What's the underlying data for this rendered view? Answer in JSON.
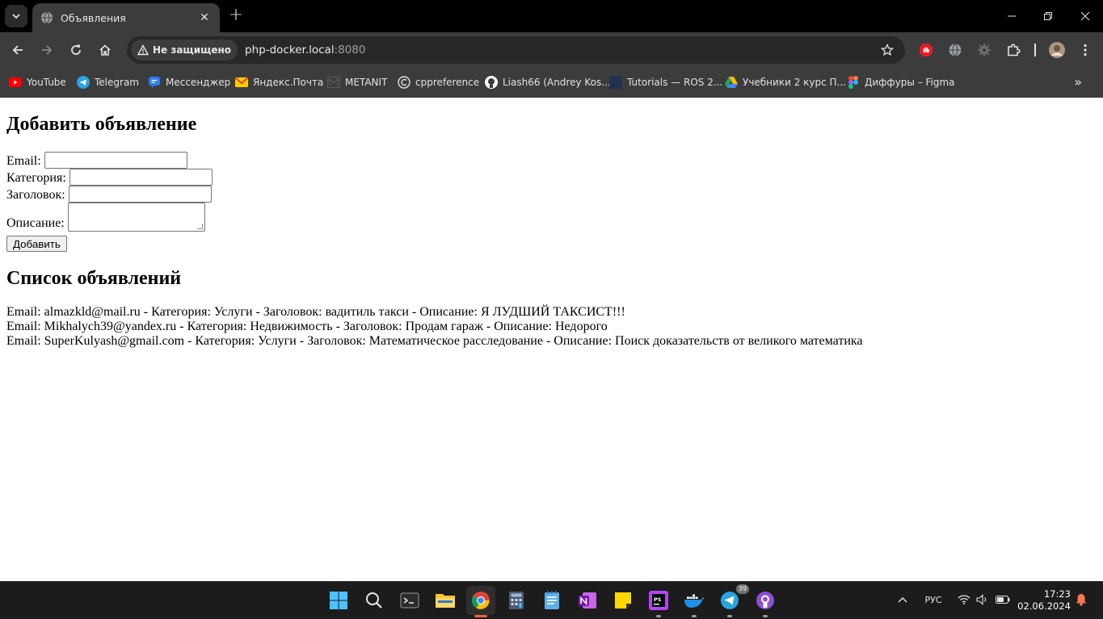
{
  "browser": {
    "tab": {
      "title": "Объявления",
      "favicon": "globe-icon"
    },
    "address": {
      "security_label": "Не защищено",
      "host": "php-docker.local",
      "port": ":8080"
    },
    "bookmarks": [
      {
        "label": "YouTube",
        "icon": "youtube-icon",
        "color": "#ff0000"
      },
      {
        "label": "Telegram",
        "icon": "telegram-icon",
        "color": "#2aa3df"
      },
      {
        "label": "Мессенджер",
        "icon": "messenger-icon",
        "color": "#2f7cf6"
      },
      {
        "label": "Яндекс.Почта",
        "icon": "mail-icon",
        "color": "#ffcc00"
      },
      {
        "label": "METANIT",
        "icon": "metanit-icon",
        "color": "#5a5a5a"
      },
      {
        "label": "cppreference",
        "icon": "cppreference-icon",
        "color": "#e3e3e3"
      },
      {
        "label": "Liash66 (Andrey Kos...",
        "icon": "github-icon",
        "color": "#ffffff"
      },
      {
        "label": "Tutorials — ROS 2...",
        "icon": "ros-icon",
        "color": "#22314e"
      },
      {
        "label": "Учебники 2 курс П...",
        "icon": "google-drive-icon",
        "color": "#1fa463"
      },
      {
        "label": "Диффуры – Figma",
        "icon": "figma-icon",
        "color": "#f24e1e"
      }
    ]
  },
  "page": {
    "form_heading": "Добавить объявление",
    "fields": {
      "email_label": "Email:",
      "category_label": "Категория:",
      "title_label": "Заголовок:",
      "description_label": "Описание:"
    },
    "submit_label": "Добавить",
    "list_heading": "Список объявлений",
    "ads": [
      "Email: almazkld@mail.ru - Категория: Услуги - Заголовок: вадитиль такси - Описание: Я ЛУДШИЙ ТАКСИСТ!!!",
      "Email: Mikhalych39@yandex.ru - Категория: Недвижимость - Заголовок: Продам гараж - Описание: Недорого",
      "Email: SuperKulyash@gmail.com - Категория: Услуги - Заголовок: Математическое расследование - Описание: Поиск доказательств от великого математика"
    ]
  },
  "taskbar": {
    "apps": [
      "start-icon",
      "search-icon",
      "terminal-icon",
      "file-explorer-icon",
      "chrome-icon",
      "calculator-icon",
      "notepad-icon",
      "onenote-icon",
      "sticky-notes-icon",
      "phpstorm-icon",
      "docker-icon",
      "telegram-icon",
      "github-desktop-icon"
    ],
    "telegram_badge": "39",
    "language": "РУС",
    "time": "17:23",
    "date": "02.06.2024"
  }
}
